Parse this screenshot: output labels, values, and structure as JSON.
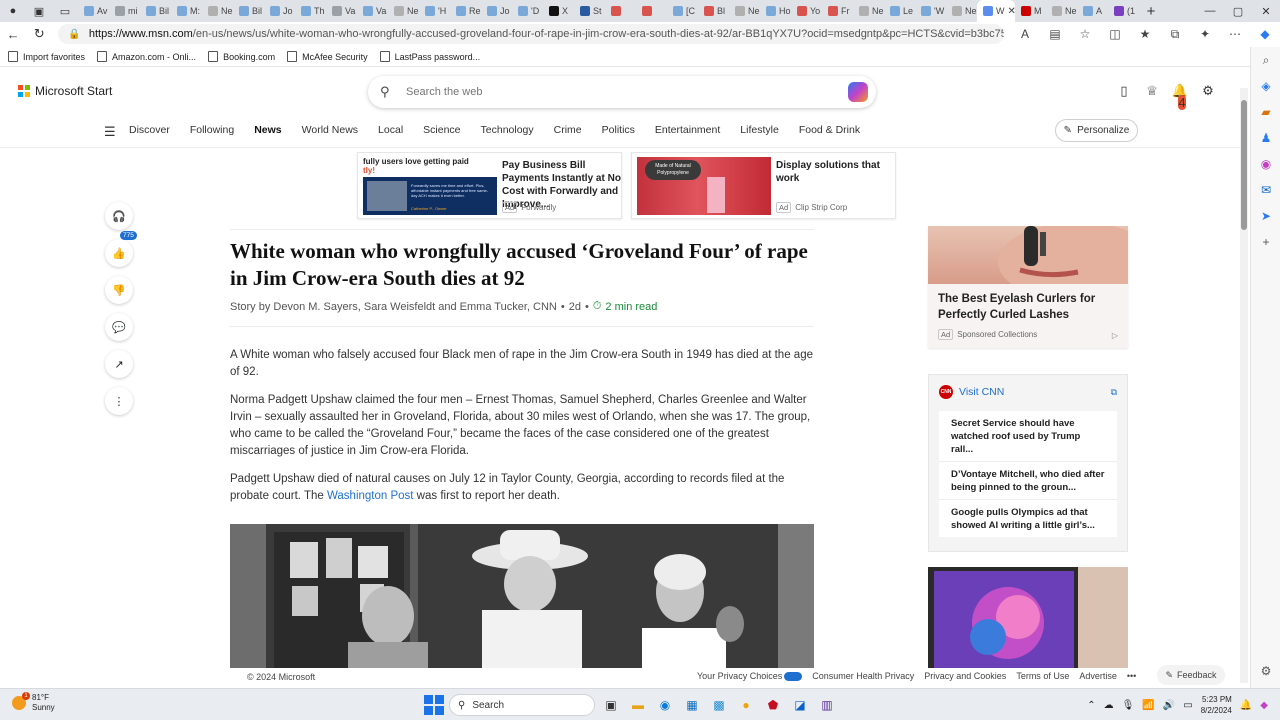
{
  "browser": {
    "tabs": [
      {
        "label": "Av",
        "color": "#7aa8d8"
      },
      {
        "label": "mi",
        "color": "#9aa0a6"
      },
      {
        "label": "Bil",
        "color": "#7aa8d8"
      },
      {
        "label": "M:",
        "color": "#7aa8d8"
      },
      {
        "label": "Ne",
        "color": "#b0b0b0"
      },
      {
        "label": "Bil",
        "color": "#7aa8d8"
      },
      {
        "label": "Jo",
        "color": "#7aa8d8"
      },
      {
        "label": "Th",
        "color": "#7aa8d8"
      },
      {
        "label": "Va",
        "color": "#9aa0a6"
      },
      {
        "label": "Va",
        "color": "#7aa8d8"
      },
      {
        "label": "Ne",
        "color": "#b0b0b0"
      },
      {
        "label": "'H",
        "color": "#7aa8d8"
      },
      {
        "label": "Re",
        "color": "#7aa8d8"
      },
      {
        "label": "Jo",
        "color": "#7aa8d8"
      },
      {
        "label": "'D",
        "color": "#7aa8d8"
      },
      {
        "label": "X",
        "color": "#111111"
      },
      {
        "label": "St",
        "color": "#2a5aa0"
      },
      {
        "label": "",
        "color": "#d9534f"
      },
      {
        "label": "",
        "color": "#d9534f"
      },
      {
        "label": "[C",
        "color": "#7aa8d8"
      },
      {
        "label": "Bl",
        "color": "#d9534f"
      },
      {
        "label": "Ne",
        "color": "#b0b0b0"
      },
      {
        "label": "Ho",
        "color": "#7aa8d8"
      },
      {
        "label": "Yo",
        "color": "#d9534f"
      },
      {
        "label": "Fr",
        "color": "#d9534f"
      },
      {
        "label": "Ne",
        "color": "#b0b0b0"
      },
      {
        "label": "Le",
        "color": "#7aa8d8"
      },
      {
        "label": "'W",
        "color": "#7aa8d8"
      },
      {
        "label": "Ne",
        "color": "#b0b0b0"
      }
    ],
    "active_tab": {
      "label": "W",
      "color": "#5b8def"
    },
    "tabs_after": [
      {
        "label": "M",
        "color": "#cc0000"
      },
      {
        "label": "Ne",
        "color": "#b0b0b0"
      },
      {
        "label": "A",
        "color": "#7aa8d8"
      },
      {
        "label": "(1",
        "color": "#7a3fc0"
      }
    ],
    "url_host": "https://www.msn.com",
    "url_path": "/en-us/news/us/white-woman-who-wrongfully-accused-groveland-four-of-rape-in-jim-crow-era-south-dies-at-92/ar-BB1qYX7U?ocid=msedgntp&pc=HCTS&cvid=b3bc753fe75345ec8269f6e81ba887...",
    "favorites": [
      "Import favorites",
      "Amazon.com - Onli...",
      "Booking.com",
      "McAfee Security",
      "LastPass password..."
    ]
  },
  "msn": {
    "brand": "Microsoft Start",
    "search_placeholder": "Search the web",
    "notification_count": "4",
    "nav": [
      "Discover",
      "Following",
      "News",
      "World News",
      "Local",
      "Science",
      "Technology",
      "Crime",
      "Politics",
      "Entertainment",
      "Lifestyle",
      "Food & Drink"
    ],
    "nav_active": "News",
    "personalize_label": "Personalize"
  },
  "top_ads": [
    {
      "title": "Pay Business Bill Payments Instantly at No Cost with Forwardly and Improve...",
      "ad_label": "Ad",
      "source": "Forwardly",
      "img_text": "fully users love getting paid",
      "img_subtext": "tly!",
      "img_fine": "Forwardly saves me time and effort. Plus, affordable instant payments and free same-day ACH makes it even better.",
      "img_sign": "Catherine P., Owner"
    },
    {
      "title": "Display solutions that work",
      "ad_label": "Ad",
      "source": "Clip Strip Corp",
      "img_text": "Made of Natural Polypropylene"
    }
  ],
  "rail": {
    "like_count": "775"
  },
  "article": {
    "headline": "White woman who wrongfully accused ‘Groveland Four’ of rape in Jim Crow-era South dies at 92",
    "byline": "Story by Devon M. Sayers, Sara Weisfeldt and Emma Tucker, CNN",
    "age": "2d",
    "read_time": "2 min read",
    "p1": "A White woman who falsely accused four Black men of rape in the Jim Crow-era South in 1949 has died at the age of 92.",
    "p2": "Norma Padgett Upshaw claimed the four men – Ernest Thomas, Samuel Shepherd, Charles Greenlee and Walter Irvin – sexually assaulted her in Groveland, Florida, about 30 miles west of Orlando, when she was 17. The group, who came to be called the “Groveland Four,” became the faces of the case considered one of the greatest miscarriages of justice in Jim Crow-era Florida.",
    "p3_before": "Padgett Upshaw died of natural causes on July 12 in Taylor County, Georgia, according to records filed at the probate court. The ",
    "p3_link": "Washington Post",
    "p3_after": " was first to report her death."
  },
  "right": {
    "ad_title": "The Best Eyelash Curlers for Perfectly Curled Lashes",
    "ad_label": "Ad",
    "ad_source": "Sponsored Collections",
    "cnn_logo": "CNN",
    "cnn_visit": "Visit CNN",
    "cnn_items": [
      "Secret Service should have watched roof used by Trump rall...",
      "D’Vontaye Mitchell, who died after being pinned to the groun...",
      "Google pulls Olympics ad that showed AI writing a little girl’s..."
    ]
  },
  "footer": {
    "copyright": "© 2024 Microsoft",
    "links": [
      "Your Privacy Choices",
      "Consumer Health Privacy",
      "Privacy and Cookies",
      "Terms of Use",
      "Advertise"
    ],
    "feedback": "Feedback"
  },
  "taskbar": {
    "temp": "81°F",
    "condition": "Sunny",
    "weather_badge": "1",
    "search_label": "Search",
    "time": "5:23 PM",
    "date": "8/2/2024"
  }
}
